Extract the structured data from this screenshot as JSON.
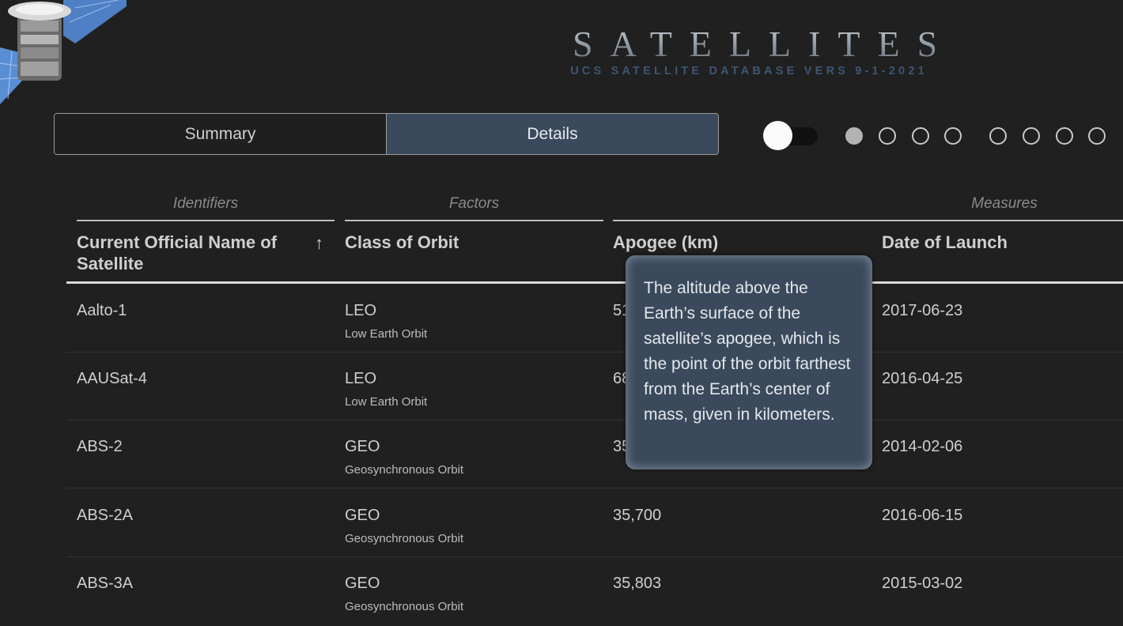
{
  "header": {
    "title": "SATELLITES",
    "subtitle": "UCS SATELLITE DATABASE VERS 9-1-2021"
  },
  "tabs": [
    {
      "label": "Summary",
      "active": false
    },
    {
      "label": "Details",
      "active": true
    }
  ],
  "toggle": {
    "on": false
  },
  "pager": {
    "page_count": 8,
    "current_page": 1
  },
  "table": {
    "groups": [
      "Identifiers",
      "Factors",
      "Measures"
    ],
    "columns": [
      "Current Official Name of Satellite",
      "Class of Orbit",
      "Apogee (km)",
      "Date of Launch"
    ],
    "sort_indicator": "↑",
    "rows": [
      {
        "name": "Aalto-1",
        "orbit": "LEO",
        "orbit_full": "Low Earth Orbit",
        "apogee": "51",
        "launch": "2017-06-23"
      },
      {
        "name": "AAUSat-4",
        "orbit": "LEO",
        "orbit_full": "Low Earth Orbit",
        "apogee": "68",
        "launch": "2016-04-25"
      },
      {
        "name": "ABS-2",
        "orbit": "GEO",
        "orbit_full": "Geosynchronous Orbit",
        "apogee": "35",
        "launch": "2014-02-06"
      },
      {
        "name": "ABS-2A",
        "orbit": "GEO",
        "orbit_full": "Geosynchronous Orbit",
        "apogee": "35,700",
        "launch": "2016-06-15"
      },
      {
        "name": "ABS-3A",
        "orbit": "GEO",
        "orbit_full": "Geosynchronous Orbit",
        "apogee": "35,803",
        "launch": "2015-03-02"
      }
    ]
  },
  "tooltip": {
    "text": "The altitude above the Earth’s surface of the satellite’s apogee, which is the point of the orbit farthest from the Earth’s center of mass, given in kilometers."
  }
}
